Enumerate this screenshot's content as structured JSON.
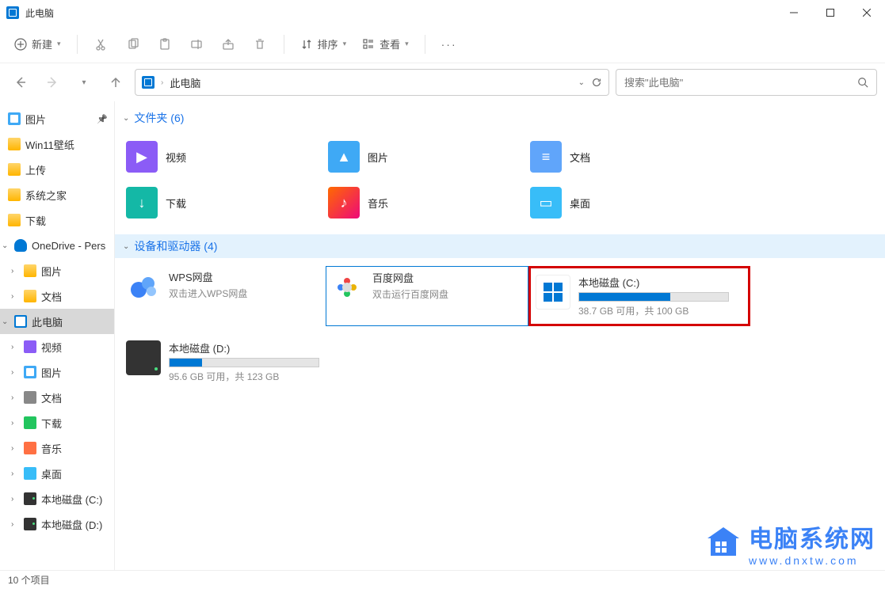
{
  "window": {
    "title": "此电脑"
  },
  "toolbar": {
    "new": "新建",
    "sort": "排序",
    "view": "查看"
  },
  "nav": {
    "breadcrumb": "此电脑",
    "search_placeholder": "搜索\"此电脑\""
  },
  "sidebar": {
    "items": [
      {
        "label": "图片",
        "type": "pic",
        "pin": true
      },
      {
        "label": "Win11壁纸",
        "type": "folder"
      },
      {
        "label": "上传",
        "type": "folder"
      },
      {
        "label": "系统之家",
        "type": "folder"
      },
      {
        "label": "下载",
        "type": "folder"
      },
      {
        "label": "OneDrive - Pers",
        "type": "onedrive",
        "chev": "down"
      },
      {
        "label": "图片",
        "type": "folder",
        "chev": "right",
        "indent": true
      },
      {
        "label": "文档",
        "type": "folder",
        "chev": "right",
        "indent": true
      },
      {
        "label": "此电脑",
        "type": "pc",
        "chev": "down",
        "selected": true
      },
      {
        "label": "视频",
        "type": "video",
        "chev": "right",
        "indent": true
      },
      {
        "label": "图片",
        "type": "pic",
        "chev": "right",
        "indent": true
      },
      {
        "label": "文档",
        "type": "doc",
        "chev": "right",
        "indent": true
      },
      {
        "label": "下载",
        "type": "download",
        "chev": "right",
        "indent": true
      },
      {
        "label": "音乐",
        "type": "music",
        "chev": "right",
        "indent": true
      },
      {
        "label": "桌面",
        "type": "desktop",
        "chev": "right",
        "indent": true
      },
      {
        "label": "本地磁盘 (C:)",
        "type": "drive",
        "chev": "right",
        "indent": true
      },
      {
        "label": "本地磁盘 (D:)",
        "type": "drive",
        "chev": "right",
        "indent": true
      }
    ]
  },
  "sections": {
    "folders": {
      "header": "文件夹 (6)",
      "items": [
        {
          "label": "视频",
          "icon": "video"
        },
        {
          "label": "图片",
          "icon": "pic"
        },
        {
          "label": "文档",
          "icon": "doc"
        },
        {
          "label": "下载",
          "icon": "download"
        },
        {
          "label": "音乐",
          "icon": "music"
        },
        {
          "label": "桌面",
          "icon": "desktop"
        }
      ]
    },
    "drives": {
      "header": "设备和驱动器 (4)",
      "items": [
        {
          "name": "WPS网盘",
          "sub": "双击进入WPS网盘",
          "type": "wps"
        },
        {
          "name": "百度网盘",
          "sub": "双击运行百度网盘",
          "type": "baidu",
          "selected": true
        },
        {
          "name": "本地磁盘 (C:)",
          "sub": "38.7 GB 可用，共 100 GB",
          "type": "win",
          "bar_pct": 61,
          "highlight": true
        },
        {
          "name": "本地磁盘 (D:)",
          "sub": "95.6 GB 可用，共 123 GB",
          "type": "disk",
          "bar_pct": 22
        }
      ]
    }
  },
  "statusbar": {
    "text": "10 个项目"
  },
  "watermark": {
    "text1": "电脑系统网",
    "text2": "www.dnxtw.com"
  }
}
